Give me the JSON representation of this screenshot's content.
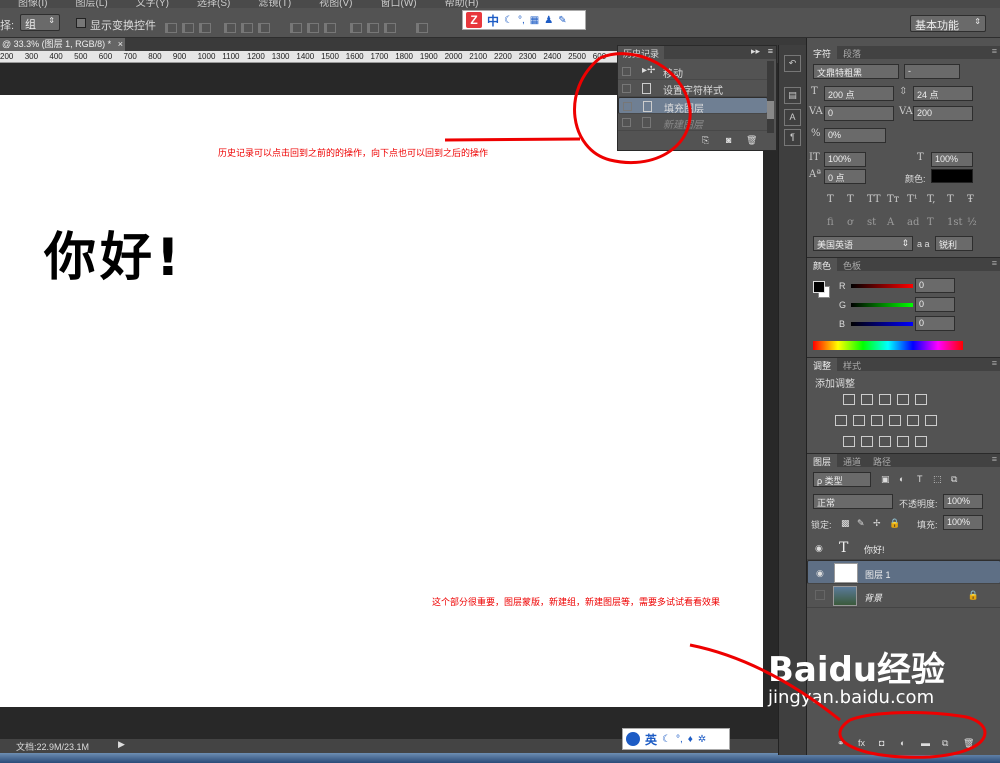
{
  "menu": [
    "图像(I)",
    "图层(L)",
    "文字(Y)",
    "选择(S)",
    "滤镜(T)",
    "视图(V)",
    "窗口(W)",
    "帮助(H)"
  ],
  "options": {
    "select_label": "择:",
    "select_value": "组",
    "show_transform": "显示变换控件",
    "workspace": "基本功能"
  },
  "ime_top": {
    "logo": "Z",
    "lang": "中"
  },
  "document": {
    "tab": "@ 33.3% (图层 1, RGB/8) *",
    "ruler": [
      "200",
      "300",
      "400",
      "500",
      "600",
      "700",
      "800",
      "900",
      "1000",
      "1100",
      "1200",
      "1300",
      "1400",
      "1500",
      "1600",
      "1700",
      "1800",
      "1900",
      "2000",
      "2100",
      "2200",
      "2300",
      "2400",
      "2500",
      "600"
    ],
    "canvas_text": "你好!",
    "status": "文档:22.9M/23.1M"
  },
  "annotations": {
    "history_note": "历史记录可以点击回到之前的的操作，向下点也可以回到之后的操作",
    "layers_note": "这个部分很重要，图层蒙版，新建组，新建图层等，需要多试试看看效果"
  },
  "history": {
    "title": "历史记录",
    "items": [
      "移动",
      "设置字符样式",
      "填充图层",
      "新建图层"
    ],
    "selected_index": 2
  },
  "character": {
    "tabs": [
      "字符",
      "段落"
    ],
    "font": "文鼎特粗黑",
    "font_style": "-",
    "size": "200 点",
    "leading": "24 点",
    "kerning": "0",
    "tracking": "200",
    "scale_percent": "0%",
    "v_scale": "100%",
    "h_scale": "100%",
    "baseline": "0 点",
    "color_label": "颜色:",
    "language": "美国英语",
    "aa_label": "a a",
    "antialias": "锐利",
    "style_buttons": [
      "T",
      "T",
      "TT",
      "Tт",
      "T¹",
      "T,",
      "T",
      "Ŧ"
    ],
    "ot_buttons": [
      "fi",
      "ơ",
      "st",
      "A",
      "ad",
      "T",
      "1st",
      "½"
    ]
  },
  "color_panel": {
    "tabs": [
      "颜色",
      "色板"
    ],
    "channels": [
      {
        "name": "R",
        "value": "0"
      },
      {
        "name": "G",
        "value": "0"
      },
      {
        "name": "B",
        "value": "0"
      }
    ]
  },
  "adjust_panel": {
    "tabs": [
      "调整",
      "样式"
    ],
    "title": "添加调整"
  },
  "layers_panel": {
    "tabs": [
      "图层",
      "通道",
      "路径"
    ],
    "filter": "ρ 类型",
    "blend_mode": "正常",
    "opacity_label": "不透明度:",
    "opacity": "100%",
    "lock_label": "锁定:",
    "fill_label": "填充:",
    "fill": "100%",
    "layers": [
      {
        "name": "你好!",
        "kind": "text"
      },
      {
        "name": "图层 1",
        "kind": "pixel"
      },
      {
        "name": "背景",
        "kind": "background"
      }
    ],
    "footer_icons": [
      "link-icon",
      "fx-icon",
      "mask-icon",
      "adjustment-icon",
      "group-icon",
      "new-layer-icon",
      "trash-icon"
    ]
  },
  "ime_bottom": {
    "lang": "英"
  },
  "watermark": {
    "brand": "Baidu经验",
    "url": "jingyan.baidu.com"
  },
  "colors": {
    "annotation": "#e00000",
    "selected_row": "#6f7f93",
    "panel_bg": "#535353"
  }
}
